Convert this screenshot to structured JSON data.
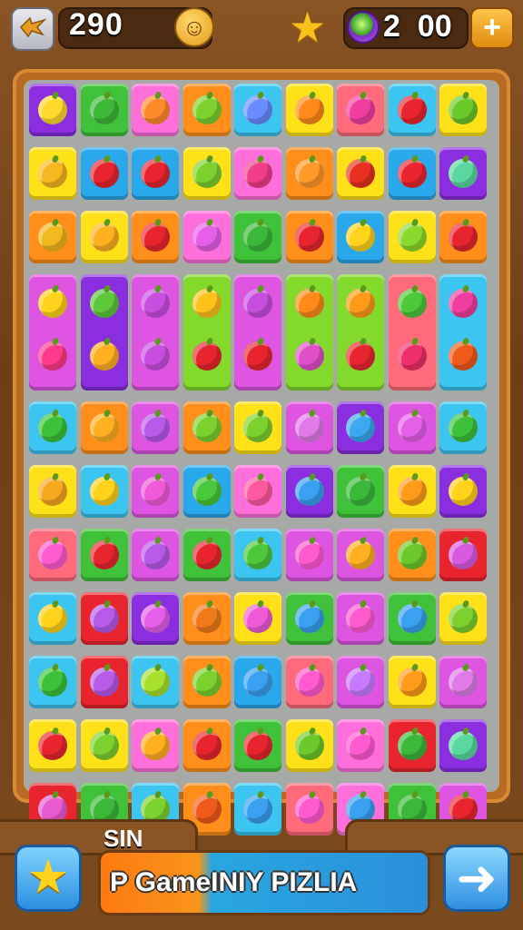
{
  "hud": {
    "back_icon": "bird-back-icon",
    "score": "290",
    "face_icon": "smiley-face-icon",
    "star_icon": "star-icon",
    "gem_icon": "gem-icon",
    "coins": "2  00",
    "plus_label": "+"
  },
  "colors": {
    "yellow": "#ffe11a",
    "green": "#3fc23a",
    "pink": "#ff6fdc",
    "orange": "#ff8f1a",
    "blue": "#2aa8ec",
    "red": "#e8252e",
    "purple": "#8a2ee0",
    "lime": "#83d92c",
    "salmon": "#ff6b7a",
    "cyan": "#3cc5f0",
    "magenta": "#dd55e0"
  },
  "board": {
    "rows": [
      [
        [
          "purple",
          "#ffd92e"
        ],
        [
          "green",
          "#3fb83a"
        ],
        [
          "pink",
          "#ff8a2a"
        ],
        [
          "orange",
          "#7cd12e"
        ],
        [
          "cyan",
          "#6a8cff"
        ],
        [
          "yellow",
          "#ff8a1a"
        ],
        [
          "salmon",
          "#f03ea0"
        ],
        [
          "cyan",
          "#e8252e"
        ],
        [
          "yellow",
          "#6cc92a"
        ]
      ],
      [
        [
          "yellow",
          "#f7b81f"
        ],
        [
          "blue",
          "#e8252e"
        ],
        [
          "blue",
          "#e8252e"
        ],
        [
          "yellow",
          "#7cd12e"
        ],
        [
          "pink",
          "#f03e8a"
        ],
        [
          "orange",
          "#ff9a2a"
        ],
        [
          "yellow",
          "#e83020"
        ],
        [
          "blue",
          "#e8252e"
        ],
        [
          "purple",
          "#5ad8a0"
        ]
      ],
      [
        [
          "orange",
          "#f2b81f"
        ],
        [
          "yellow",
          "#ffb020"
        ],
        [
          "orange",
          "#e8252e"
        ],
        [
          "pink",
          "#e65fe8"
        ],
        [
          "green",
          "#3bb83a"
        ],
        [
          "orange",
          "#e8252e"
        ],
        [
          "blue",
          "#ffd21c"
        ],
        [
          "yellow",
          "#8ad92e"
        ],
        [
          "orange",
          "#e8252e"
        ]
      ],
      [
        [
          "magenta",
          "#ffd21c",
          "#ff3a8a"
        ],
        [
          "purple",
          "#5cc83a",
          "#ffb020"
        ],
        [
          "magenta",
          "#c84ee0",
          "#c84ee0"
        ],
        [
          "lime",
          "#ffc21c",
          "#e8252e"
        ],
        [
          "magenta",
          "#c84ee0",
          "#e8252e"
        ],
        [
          "lime",
          "#ff8a1a",
          "#e04ec8"
        ],
        [
          "lime",
          "#ff9a1a",
          "#e8252e"
        ],
        [
          "salmon",
          "#4cc83a",
          "#f0306a"
        ],
        [
          "cyan",
          "#f03ea0",
          "#f05a1a"
        ]
      ],
      [
        [
          "cyan",
          "#3cc23a"
        ],
        [
          "orange",
          "#ffb020"
        ],
        [
          "magenta",
          "#b85ae8"
        ],
        [
          "orange",
          "#7cd12e"
        ],
        [
          "yellow",
          "#7cd12e"
        ],
        [
          "magenta",
          "#e07ae8"
        ],
        [
          "purple",
          "#3ca8f0"
        ],
        [
          "magenta",
          "#e65fe8"
        ],
        [
          "cyan",
          "#3cc23a"
        ]
      ],
      [
        [
          "yellow",
          "#f7a81f"
        ],
        [
          "cyan",
          "#ffd21c"
        ],
        [
          "magenta",
          "#f05ad8"
        ],
        [
          "blue",
          "#48c83a"
        ],
        [
          "pink",
          "#ff5aa0"
        ],
        [
          "purple",
          "#3aa0f0"
        ],
        [
          "green",
          "#3bb83a"
        ],
        [
          "yellow",
          "#ff9a1a"
        ],
        [
          "purple",
          "#ffd21c"
        ]
      ],
      [
        [
          "salmon",
          "#ff5ad0"
        ],
        [
          "green",
          "#e8252e"
        ],
        [
          "magenta",
          "#b85ae8"
        ],
        [
          "green",
          "#e8252e"
        ],
        [
          "cyan",
          "#4cc83a"
        ],
        [
          "magenta",
          "#ff5ad0"
        ],
        [
          "magenta",
          "#ffb020"
        ],
        [
          "orange",
          "#6cc92a"
        ],
        [
          "red",
          "#d85ae0"
        ]
      ],
      [
        [
          "cyan",
          "#ffd21c"
        ],
        [
          "red",
          "#b85ae8"
        ],
        [
          "purple",
          "#e65fe8"
        ],
        [
          "orange",
          "#f07a1a"
        ],
        [
          "yellow",
          "#f05ad8"
        ],
        [
          "green",
          "#3aa0f0"
        ],
        [
          "magenta",
          "#ff5ad0"
        ],
        [
          "green",
          "#3aa0f0"
        ],
        [
          "yellow",
          "#7cd12e"
        ]
      ],
      [
        [
          "cyan",
          "#3cc23a"
        ],
        [
          "red",
          "#b85ae8"
        ],
        [
          "cyan",
          "#a8e02e"
        ],
        [
          "orange",
          "#7cd12e"
        ],
        [
          "blue",
          "#3aa0f0"
        ],
        [
          "salmon",
          "#ff5ad0"
        ],
        [
          "magenta",
          "#c87aff"
        ],
        [
          "yellow",
          "#ff9a1a"
        ],
        [
          "magenta",
          "#e07ae8"
        ]
      ],
      [
        [
          "yellow",
          "#e8252e"
        ],
        [
          "yellow",
          "#7cd12e"
        ],
        [
          "pink",
          "#ffb020"
        ],
        [
          "orange",
          "#e8252e"
        ],
        [
          "green",
          "#e8252e"
        ],
        [
          "yellow",
          "#6cc92a"
        ],
        [
          "pink",
          "#ff5ad0"
        ],
        [
          "red",
          "#3cb83a"
        ],
        [
          "purple",
          "#5ad8a0"
        ]
      ],
      [
        [
          "red",
          "#e85ad0"
        ],
        [
          "green",
          "#3bb83a"
        ],
        [
          "cyan",
          "#7cd12e"
        ],
        [
          "orange",
          "#f05a1a"
        ],
        [
          "cyan",
          "#3aa0f0"
        ],
        [
          "salmon",
          "#ff5ad0"
        ],
        [
          "pink",
          "#3aa0f0"
        ],
        [
          "green",
          "#3bb83a"
        ],
        [
          "magenta",
          "#e8252e"
        ]
      ]
    ]
  },
  "bottom": {
    "tab_label": "SIN",
    "star_icon": "star-icon",
    "banner_text": "P GameINIY PIZLIA",
    "arrow_icon": "arrow-right-icon"
  }
}
